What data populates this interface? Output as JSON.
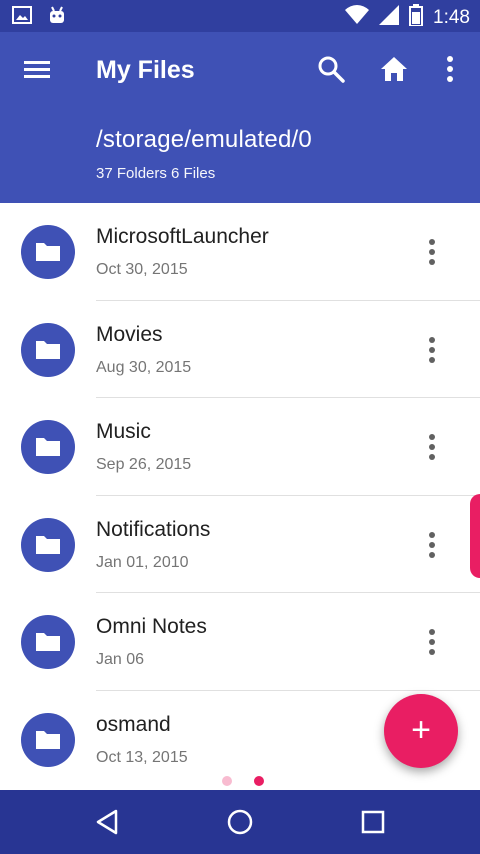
{
  "status_bar": {
    "time": "1:48",
    "icons": [
      "image-icon",
      "android-icon",
      "wifi-icon",
      "signal-icon",
      "battery-icon"
    ]
  },
  "app_bar": {
    "title": "My Files",
    "path": "/storage/emulated/0",
    "counts": "37 Folders 6 Files",
    "icons": [
      "menu-icon",
      "search-icon",
      "home-icon",
      "overflow-menu-icon"
    ]
  },
  "files": [
    {
      "name": "MicrosoftLauncher",
      "date": "Oct 30, 2015"
    },
    {
      "name": "Movies",
      "date": "Aug 30, 2015"
    },
    {
      "name": "Music",
      "date": "Sep 26, 2015"
    },
    {
      "name": "Notifications",
      "date": "Jan 01, 2010"
    },
    {
      "name": "Omni Notes",
      "date": "Jan 06"
    },
    {
      "name": "osmand",
      "date": "Oct 13, 2015"
    }
  ],
  "fab": {
    "label": "+"
  },
  "page_indicator": {
    "count": 2,
    "active": 2
  },
  "nav_bar": {
    "icons": [
      "back-icon",
      "home-circle-icon",
      "recents-icon"
    ]
  },
  "colors": {
    "primary": "#3f51b5",
    "primary_dark": "#303f9f",
    "accent": "#e91e63",
    "nav_bar": "#283593"
  }
}
